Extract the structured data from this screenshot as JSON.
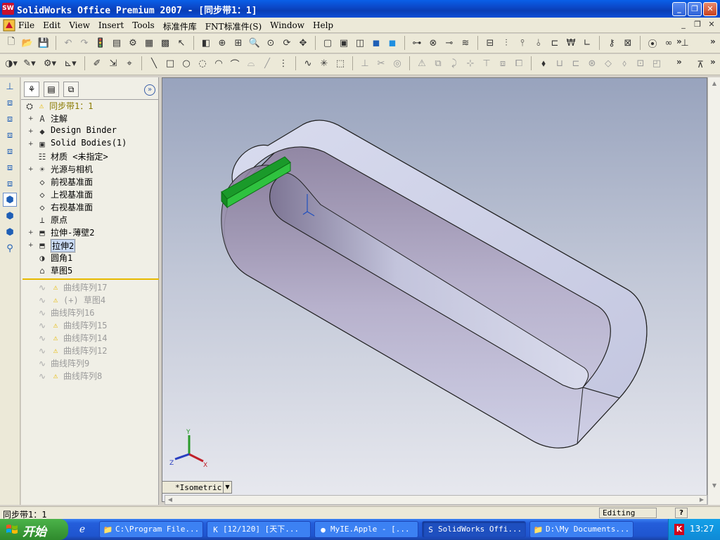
{
  "window": {
    "title": "SolidWorks Office Premium 2007 - [同步带1：1]",
    "logo": "SW",
    "minimize": "_",
    "restore": "❐",
    "close": "✕"
  },
  "menu": {
    "items": [
      "File",
      "Edit",
      "View",
      "Insert",
      "Tools",
      "标准件库",
      "FNT标准件(S)",
      "Window",
      "Help"
    ],
    "mdi_minimize": "_",
    "mdi_restore": "❐",
    "mdi_close": "✕"
  },
  "toolbar_chevron": "»",
  "feature_manager": {
    "collapse_glyph": "»",
    "root": "同步带1：1",
    "items": [
      {
        "label": "注解",
        "icon": "annotation-icon",
        "expand": "+"
      },
      {
        "label": "Design Binder",
        "icon": "design-binder-icon",
        "expand": "+"
      },
      {
        "label": "Solid Bodies(1)",
        "icon": "solid-bodies-icon",
        "expand": "+"
      },
      {
        "label": "材质 <未指定>",
        "icon": "material-icon",
        "expand": ""
      },
      {
        "label": "光源与相机",
        "icon": "lights-camera-icon",
        "expand": "+"
      },
      {
        "label": "前视基准面",
        "icon": "plane-icon",
        "expand": ""
      },
      {
        "label": "上视基准面",
        "icon": "plane-icon",
        "expand": ""
      },
      {
        "label": "右视基准面",
        "icon": "plane-icon",
        "expand": ""
      },
      {
        "label": "原点",
        "icon": "origin-icon",
        "expand": ""
      },
      {
        "label": "拉伸-薄壁2",
        "icon": "extrude-icon",
        "expand": "+"
      },
      {
        "label": "拉伸2",
        "icon": "extrude-icon",
        "expand": "+"
      },
      {
        "label": "圆角1",
        "icon": "fillet-icon",
        "expand": ""
      },
      {
        "label": "草图5",
        "icon": "sketch-icon",
        "expand": ""
      }
    ],
    "suppressed": [
      {
        "label": "曲线阵列17",
        "warn": true
      },
      {
        "label": "(+) 草图4",
        "warn": true
      },
      {
        "label": "曲线阵列16",
        "warn": false
      },
      {
        "label": "曲线阵列15",
        "warn": true
      },
      {
        "label": "曲线阵列14",
        "warn": true
      },
      {
        "label": "曲线阵列12",
        "warn": true
      },
      {
        "label": "曲线阵列9",
        "warn": false
      },
      {
        "label": "曲线阵列8",
        "warn": true
      }
    ]
  },
  "viewport": {
    "view_name": "*Isometric",
    "triad": {
      "x": "X",
      "y": "Y",
      "z": "Z"
    }
  },
  "status": {
    "left": "同步带1：1",
    "mode": "Editing Part",
    "help": "?"
  },
  "taskbar": {
    "start": "开始",
    "tasks": [
      {
        "label": "C:\\Program File...",
        "icon": "folder-icon"
      },
      {
        "label": "[12/120] [天下...",
        "icon": "app-icon"
      },
      {
        "label": "MyIE.Apple - [...",
        "icon": "browser-icon"
      },
      {
        "label": "SolidWorks Offi...",
        "icon": "solidworks-icon"
      },
      {
        "label": "D:\\My Documents...",
        "icon": "folder-icon"
      }
    ],
    "clock": "13:27",
    "tray_icon": "K"
  }
}
